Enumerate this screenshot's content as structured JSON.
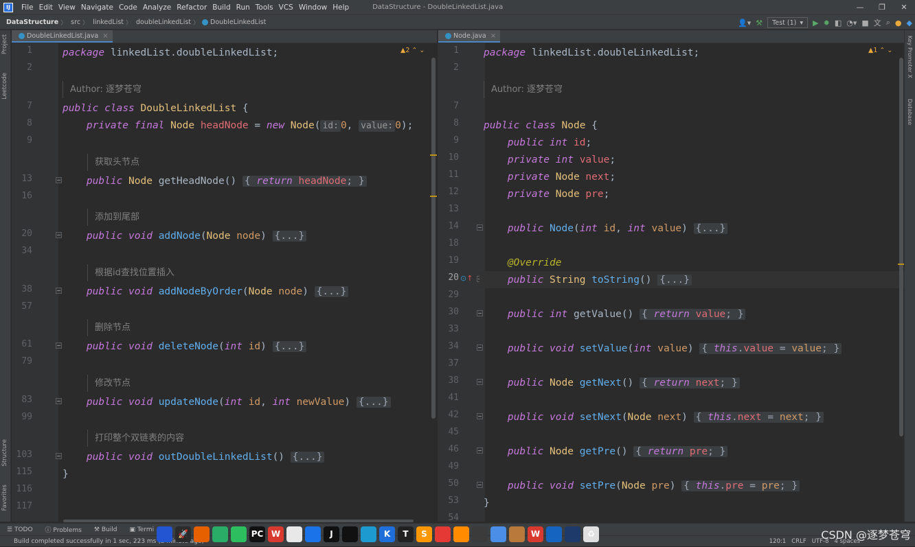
{
  "menubar": {
    "app_logo": "IJ",
    "items": [
      "File",
      "Edit",
      "View",
      "Navigate",
      "Code",
      "Analyze",
      "Refactor",
      "Build",
      "Run",
      "Tools",
      "VCS",
      "Window",
      "Help"
    ],
    "title": "DataStructure - DoubleLinkedList.java"
  },
  "window_controls": {
    "minimize": "—",
    "restore": "❐",
    "close": "✕"
  },
  "breadcrumb": {
    "project": "DataStructure",
    "items": [
      "src",
      "linkedList",
      "doubleLinkedList",
      "DoubleLinkedList"
    ]
  },
  "toolbar": {
    "run_config": "Test (1)"
  },
  "side": {
    "left": [
      "Project",
      "Leetcode",
      "Structure",
      "Favorites"
    ],
    "right": [
      "Key Promoter X",
      "Database"
    ]
  },
  "left_editor": {
    "tab": "DoubleLinkedList.java",
    "warnings": "2",
    "line_numbers": [
      "1",
      "2",
      "",
      "7",
      "8",
      "9",
      "",
      "13",
      "16",
      "",
      "20",
      "34",
      "",
      "38",
      "57",
      "",
      "61",
      "79",
      "",
      "83",
      "99",
      "",
      "103",
      "115",
      "116",
      "117"
    ],
    "kw": {
      "package": "package",
      "public": "public",
      "class": "class",
      "private": "private",
      "final": "final",
      "new": "new",
      "return": "return",
      "void": "void",
      "int": "int"
    },
    "pkg": "linkedList.doubleLinkedList;",
    "author": "Author: 逐梦苍穹",
    "class_name": "DoubleLinkedList",
    "type_node": "Node",
    "field": "headNode",
    "hint_id": "id:",
    "hint_value": "value:",
    "zero": "0",
    "c1": "获取头节点",
    "m1": "getHeadNode",
    "c2": "添加到尾部",
    "m2": "addNode",
    "p_node": "node",
    "c3": "根据id查找位置插入",
    "m3": "addNodeByOrder",
    "c4": "删除节点",
    "m4": "deleteNode",
    "p_id": "id",
    "c5": "修改节点",
    "m5": "updateNode",
    "p_newValue": "newValue",
    "c6": "打印整个双链表的内容",
    "m6": "outDoubleLinkedList",
    "folded": "{...}"
  },
  "right_editor": {
    "tab": "Node.java",
    "warnings": "1",
    "line_numbers": [
      "1",
      "2",
      "",
      "7",
      "8",
      "9",
      "10",
      "11",
      "12",
      "13",
      "14",
      "18",
      "19",
      "20",
      "29",
      "30",
      "33",
      "34",
      "37",
      "38",
      "41",
      "42",
      "45",
      "46",
      "49",
      "50",
      "53",
      "54"
    ],
    "class_name": "Node",
    "f_id": "id",
    "f_value": "value",
    "f_next": "next",
    "f_pre": "pre",
    "annotation": "@Override",
    "type_string": "String",
    "m_toString": "toString",
    "m_getValue": "getValue",
    "m_setValue": "setValue",
    "m_getNext": "getNext",
    "m_setNext": "setNext",
    "m_getPre": "getPre",
    "m_setPre": "setPre",
    "this": "this"
  },
  "bottom_tools": [
    "TODO",
    "Problems",
    "Build",
    "Termi"
  ],
  "status": {
    "message": "Build completed successfully in 1 sec, 223 ms (a minute ago)",
    "position": "120:1",
    "line_sep": "CRLF",
    "encoding": "UTF-8",
    "indent": "4 spaces"
  },
  "watermark": "CSDN @逐梦苍穹",
  "dock_icons": [
    {
      "name": "jetbrains-toolbox",
      "glyph": "",
      "color": "#2354d1"
    },
    {
      "name": "rocket",
      "glyph": "🚀",
      "color": "#2b2b2b"
    },
    {
      "name": "firefox",
      "glyph": "",
      "color": "#e66000"
    },
    {
      "name": "wechat",
      "glyph": "",
      "color": "#2aae67"
    },
    {
      "name": "evernote",
      "glyph": "",
      "color": "#2dbe60"
    },
    {
      "name": "pycharm",
      "glyph": "PC",
      "color": "#111"
    },
    {
      "name": "wps",
      "glyph": "W",
      "color": "#d93a2f"
    },
    {
      "name": "chrome",
      "glyph": "",
      "color": "#e8e8e8"
    },
    {
      "name": "docs",
      "glyph": "",
      "color": "#1a73e8"
    },
    {
      "name": "jetbrains",
      "glyph": "J",
      "color": "#111"
    },
    {
      "name": "qq",
      "glyph": "",
      "color": "#111"
    },
    {
      "name": "edge",
      "glyph": "",
      "color": "#1d9bd1"
    },
    {
      "name": "k-app",
      "glyph": "K",
      "color": "#1e6fd9"
    },
    {
      "name": "typora",
      "glyph": "T",
      "color": "#222"
    },
    {
      "name": "sublime",
      "glyph": "S",
      "color": "#ff9800"
    },
    {
      "name": "photos",
      "glyph": "",
      "color": "#e53935"
    },
    {
      "name": "search-app",
      "glyph": "",
      "color": "#ff8c00"
    },
    {
      "name": "notepad",
      "glyph": "",
      "color": "#3b3b3b"
    },
    {
      "name": "folder",
      "glyph": "",
      "color": "#4b8ee8"
    },
    {
      "name": "acorn",
      "glyph": "",
      "color": "#b8793a"
    },
    {
      "name": "wps-office",
      "glyph": "W",
      "color": "#d93a2f"
    },
    {
      "name": "notes",
      "glyph": "",
      "color": "#1565c0"
    },
    {
      "name": "finder",
      "glyph": "",
      "color": "#1d3a6b"
    },
    {
      "name": "recycle-bin",
      "glyph": "♻",
      "color": "#e0e0e0"
    }
  ]
}
